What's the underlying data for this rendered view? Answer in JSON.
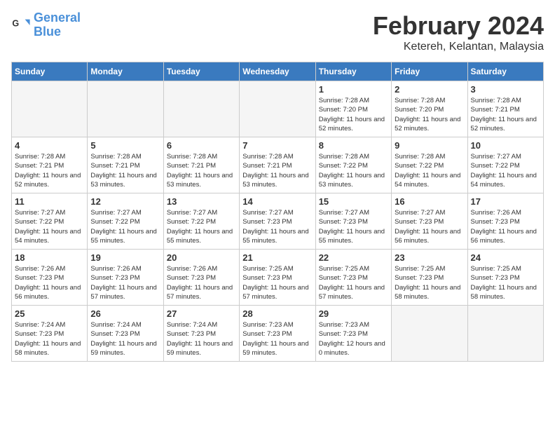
{
  "logo": {
    "text_general": "General",
    "text_blue": "Blue"
  },
  "title": "February 2024",
  "location": "Ketereh, Kelantan, Malaysia",
  "weekdays": [
    "Sunday",
    "Monday",
    "Tuesday",
    "Wednesday",
    "Thursday",
    "Friday",
    "Saturday"
  ],
  "weeks": [
    [
      {
        "day": "",
        "empty": true
      },
      {
        "day": "",
        "empty": true
      },
      {
        "day": "",
        "empty": true
      },
      {
        "day": "",
        "empty": true
      },
      {
        "day": "1",
        "sunrise": "7:28 AM",
        "sunset": "7:20 PM",
        "hours": "11 hours and 52 minutes."
      },
      {
        "day": "2",
        "sunrise": "7:28 AM",
        "sunset": "7:20 PM",
        "hours": "11 hours and 52 minutes."
      },
      {
        "day": "3",
        "sunrise": "7:28 AM",
        "sunset": "7:21 PM",
        "hours": "11 hours and 52 minutes."
      }
    ],
    [
      {
        "day": "4",
        "sunrise": "7:28 AM",
        "sunset": "7:21 PM",
        "hours": "11 hours and 52 minutes."
      },
      {
        "day": "5",
        "sunrise": "7:28 AM",
        "sunset": "7:21 PM",
        "hours": "11 hours and 53 minutes."
      },
      {
        "day": "6",
        "sunrise": "7:28 AM",
        "sunset": "7:21 PM",
        "hours": "11 hours and 53 minutes."
      },
      {
        "day": "7",
        "sunrise": "7:28 AM",
        "sunset": "7:21 PM",
        "hours": "11 hours and 53 minutes."
      },
      {
        "day": "8",
        "sunrise": "7:28 AM",
        "sunset": "7:22 PM",
        "hours": "11 hours and 53 minutes."
      },
      {
        "day": "9",
        "sunrise": "7:28 AM",
        "sunset": "7:22 PM",
        "hours": "11 hours and 54 minutes."
      },
      {
        "day": "10",
        "sunrise": "7:27 AM",
        "sunset": "7:22 PM",
        "hours": "11 hours and 54 minutes."
      }
    ],
    [
      {
        "day": "11",
        "sunrise": "7:27 AM",
        "sunset": "7:22 PM",
        "hours": "11 hours and 54 minutes."
      },
      {
        "day": "12",
        "sunrise": "7:27 AM",
        "sunset": "7:22 PM",
        "hours": "11 hours and 55 minutes."
      },
      {
        "day": "13",
        "sunrise": "7:27 AM",
        "sunset": "7:22 PM",
        "hours": "11 hours and 55 minutes."
      },
      {
        "day": "14",
        "sunrise": "7:27 AM",
        "sunset": "7:23 PM",
        "hours": "11 hours and 55 minutes."
      },
      {
        "day": "15",
        "sunrise": "7:27 AM",
        "sunset": "7:23 PM",
        "hours": "11 hours and 55 minutes."
      },
      {
        "day": "16",
        "sunrise": "7:27 AM",
        "sunset": "7:23 PM",
        "hours": "11 hours and 56 minutes."
      },
      {
        "day": "17",
        "sunrise": "7:26 AM",
        "sunset": "7:23 PM",
        "hours": "11 hours and 56 minutes."
      }
    ],
    [
      {
        "day": "18",
        "sunrise": "7:26 AM",
        "sunset": "7:23 PM",
        "hours": "11 hours and 56 minutes."
      },
      {
        "day": "19",
        "sunrise": "7:26 AM",
        "sunset": "7:23 PM",
        "hours": "11 hours and 57 minutes."
      },
      {
        "day": "20",
        "sunrise": "7:26 AM",
        "sunset": "7:23 PM",
        "hours": "11 hours and 57 minutes."
      },
      {
        "day": "21",
        "sunrise": "7:25 AM",
        "sunset": "7:23 PM",
        "hours": "11 hours and 57 minutes."
      },
      {
        "day": "22",
        "sunrise": "7:25 AM",
        "sunset": "7:23 PM",
        "hours": "11 hours and 57 minutes."
      },
      {
        "day": "23",
        "sunrise": "7:25 AM",
        "sunset": "7:23 PM",
        "hours": "11 hours and 58 minutes."
      },
      {
        "day": "24",
        "sunrise": "7:25 AM",
        "sunset": "7:23 PM",
        "hours": "11 hours and 58 minutes."
      }
    ],
    [
      {
        "day": "25",
        "sunrise": "7:24 AM",
        "sunset": "7:23 PM",
        "hours": "11 hours and 58 minutes."
      },
      {
        "day": "26",
        "sunrise": "7:24 AM",
        "sunset": "7:23 PM",
        "hours": "11 hours and 59 minutes."
      },
      {
        "day": "27",
        "sunrise": "7:24 AM",
        "sunset": "7:23 PM",
        "hours": "11 hours and 59 minutes."
      },
      {
        "day": "28",
        "sunrise": "7:23 AM",
        "sunset": "7:23 PM",
        "hours": "11 hours and 59 minutes."
      },
      {
        "day": "29",
        "sunrise": "7:23 AM",
        "sunset": "7:23 PM",
        "hours": "12 hours and 0 minutes."
      },
      {
        "day": "",
        "empty": true
      },
      {
        "day": "",
        "empty": true
      }
    ]
  ]
}
